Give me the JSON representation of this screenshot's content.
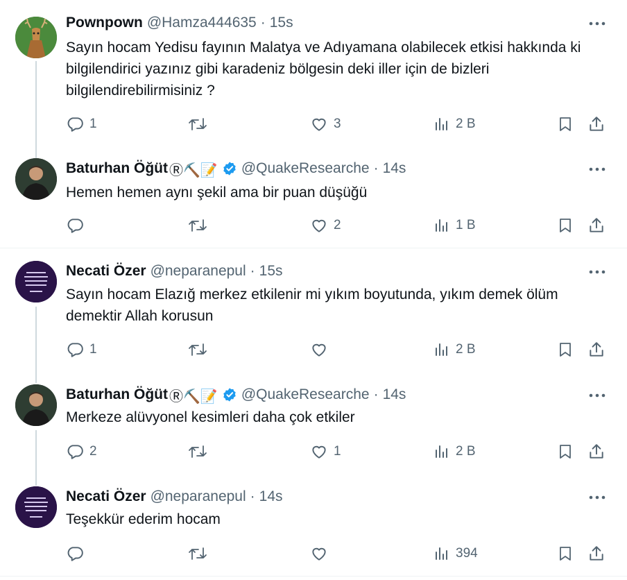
{
  "tweets": [
    {
      "name": "Pownpown",
      "handle": "@Hamza444635",
      "dot": "·",
      "time": "15s",
      "text": "Sayın hocam Yedisu fayının Malatya ve Adıyamana olabilecek etkisi hakkında ki  bilgilendirici yazınız gibi  karadeniz bölgesin deki iller için de bizleri bilgilendirebilirmisiniz ?",
      "replies": "1",
      "retweets": "",
      "likes": "3",
      "views": "2 B",
      "avatar": "deer-avatar",
      "verified": false,
      "emoji": ""
    },
    {
      "name": "Baturhan Öğüt",
      "handle": "@QuakeResearche",
      "dot": "·",
      "time": "14s",
      "text": "Hemen hemen aynı şekil ama bir puan düşüğü",
      "replies": "",
      "retweets": "",
      "likes": "2",
      "views": "1 B",
      "avatar": "person-avatar",
      "verified": true,
      "emoji": "Ⓡ⛏️📝"
    },
    {
      "name": "Necati Özer",
      "handle": "@neparanepul",
      "dot": "·",
      "time": "15s",
      "text": "Sayın hocam Elazığ merkez etkilenir mi yıkım boyutunda, yıkım demek ölüm demektir Allah korusun",
      "replies": "1",
      "retweets": "",
      "likes": "",
      "views": "2 B",
      "avatar": "purple-quote-avatar",
      "verified": false,
      "emoji": ""
    },
    {
      "name": "Baturhan Öğüt",
      "handle": "@QuakeResearche",
      "dot": "·",
      "time": "14s",
      "text": "Merkeze alüvyonel kesimleri daha çok etkiler",
      "replies": "2",
      "retweets": "",
      "likes": "1",
      "views": "2 B",
      "avatar": "person-avatar",
      "verified": true,
      "emoji": "Ⓡ⛏️📝"
    },
    {
      "name": "Necati Özer",
      "handle": "@neparanepul",
      "dot": "·",
      "time": "14s",
      "text": "Teşekkür ederim hocam",
      "replies": "",
      "retweets": "",
      "likes": "",
      "views": "394",
      "avatar": "purple-quote-avatar",
      "verified": false,
      "emoji": ""
    }
  ],
  "colors": {
    "text": "#0f1419",
    "muted": "#536471",
    "verified": "#1d9bf0",
    "thread_line": "#cfd9de",
    "separator": "#eff3f4"
  }
}
